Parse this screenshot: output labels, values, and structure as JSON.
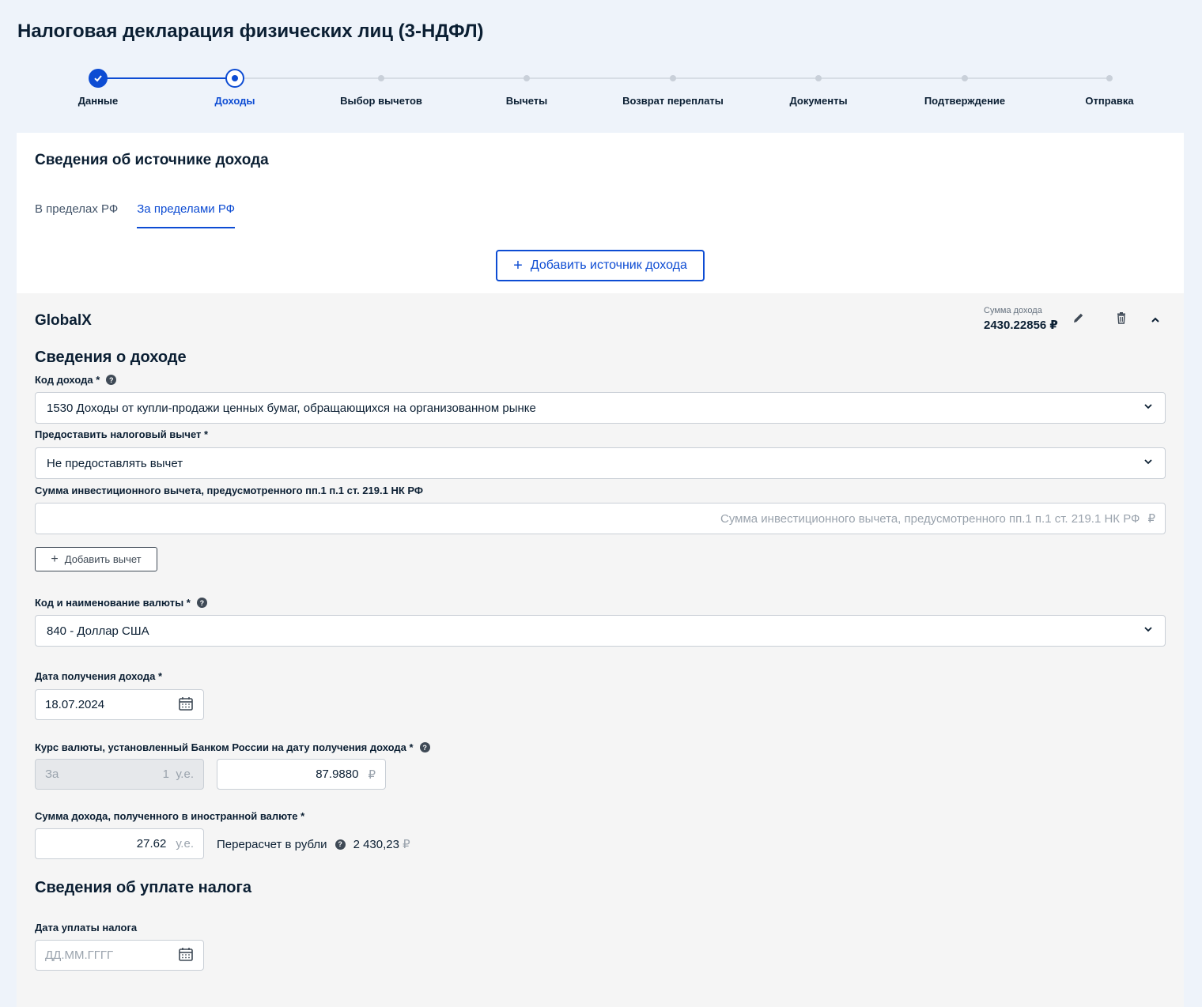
{
  "page": {
    "title": "Налоговая декларация физических лиц (3-НДФЛ)"
  },
  "stepper": {
    "steps": [
      {
        "label": "Данные",
        "state": "done"
      },
      {
        "label": "Доходы",
        "state": "current"
      },
      {
        "label": "Выбор вычетов",
        "state": "todo"
      },
      {
        "label": "Вычеты",
        "state": "todo"
      },
      {
        "label": "Возврат переплаты",
        "state": "todo"
      },
      {
        "label": "Документы",
        "state": "todo"
      },
      {
        "label": "Подтверждение",
        "state": "todo"
      },
      {
        "label": "Отправка",
        "state": "todo"
      }
    ]
  },
  "card": {
    "title": "Сведения об источнике дохода",
    "tabs": [
      {
        "label": "В пределах РФ",
        "active": false
      },
      {
        "label": "За пределами РФ",
        "active": true
      }
    ],
    "add_source_label": "Добавить источник дохода"
  },
  "source": {
    "name": "GlobalX",
    "sum_caption": "Сумма дохода",
    "sum_value": "2430.22856 ₽"
  },
  "income": {
    "section_title": "Сведения о доходе",
    "code_label": "Код дохода *",
    "code_value": "1530 Доходы от купли-продажи ценных бумаг, обращающихся на организованном рынке",
    "deduction_label": "Предоставить налоговый вычет *",
    "deduction_value": "Не предоставлять вычет",
    "invest_label": "Сумма инвестиционного вычета, предусмотренного пп.1 п.1 ст. 219.1 НК РФ",
    "invest_placeholder": "Сумма инвестиционного вычета, предусмотренного пп.1 п.1 ст. 219.1 НК РФ",
    "invest_suffix": "₽",
    "add_deduction_label": "Добавить вычет",
    "currency_label": "Код и наименование валюты  *",
    "currency_value": "840 - Доллар США",
    "date_label": "Дата получения дохода *",
    "date_value": "18.07.2024",
    "rate_label": "Курс валюты, установленный Банком России на дату получения дохода *",
    "rate_for": "За",
    "rate_units": "1",
    "rate_units_suffix": "у.е.",
    "rate_value": "87.9880",
    "rate_suffix": "₽",
    "foreign_sum_label": "Сумма дохода, полученного в иностранной валюте *",
    "foreign_sum_value": "27.62",
    "foreign_sum_suffix": "у.е.",
    "convert_label": "Перерасчет в рубли",
    "convert_value": "2 430,23",
    "convert_suffix": "₽"
  },
  "tax": {
    "section_title": "Сведения об уплате налога",
    "date_label": "Дата уплаты налога",
    "date_placeholder": "ДД.ММ.ГГГГ"
  },
  "colors": {
    "accent": "#0d4cd3",
    "bg": "#eef3fa",
    "block": "#f5f5f5"
  },
  "icons": [
    "check-icon",
    "plus-icon",
    "pencil-icon",
    "trash-icon",
    "chevron-up-icon",
    "chevron-down-icon",
    "help-icon",
    "calendar-icon"
  ]
}
